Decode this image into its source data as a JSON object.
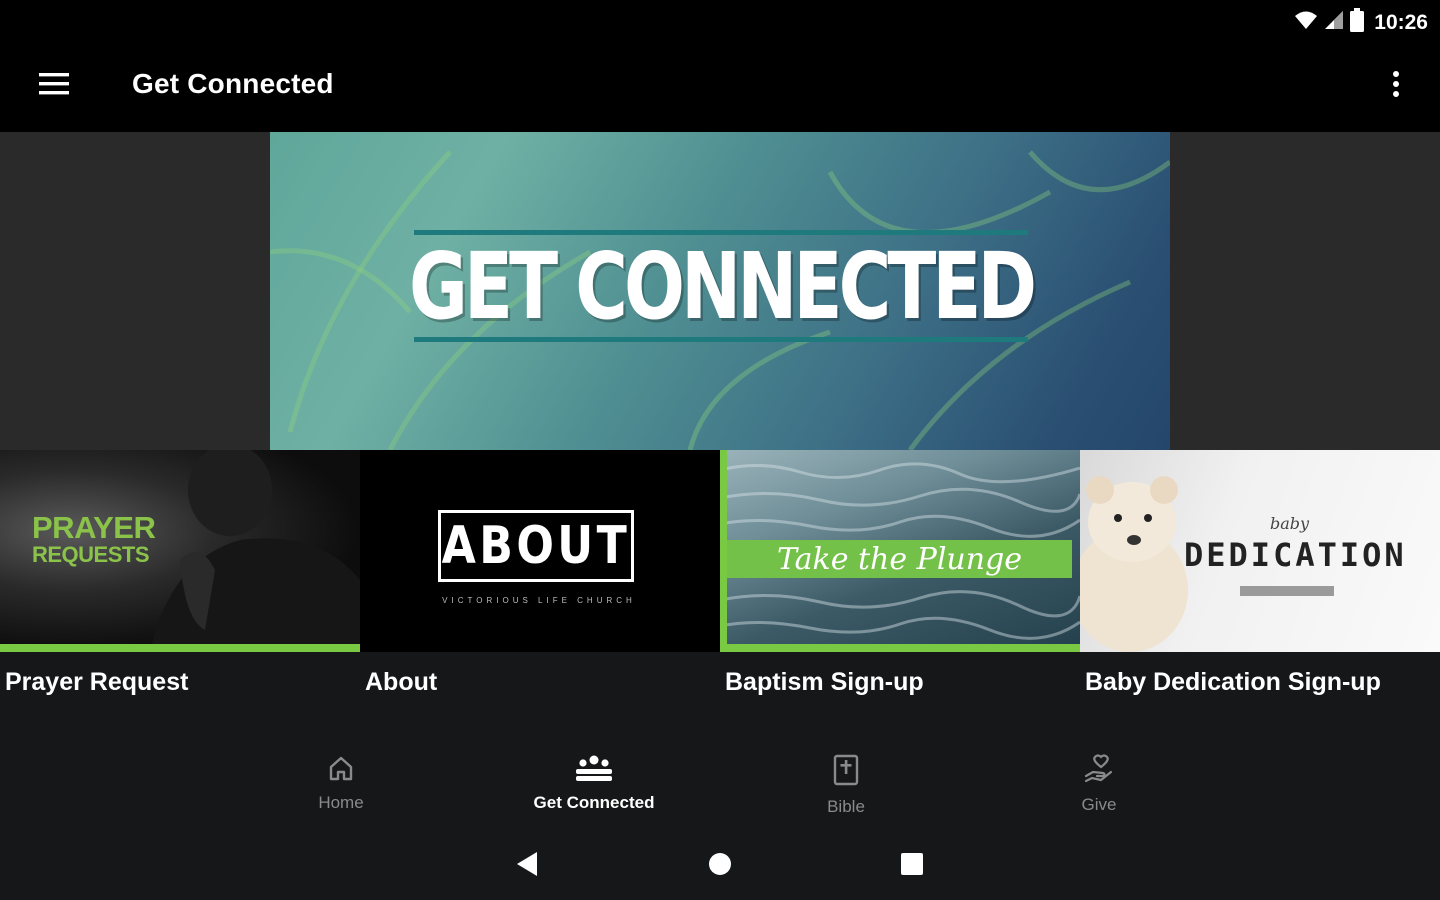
{
  "status_bar": {
    "time": "10:26",
    "icons": [
      "wifi-icon",
      "signal-icon",
      "battery-icon"
    ]
  },
  "app_bar": {
    "title": "Get Connected",
    "menu_icon": "hamburger-menu-icon",
    "overflow_icon": "more-vert-icon"
  },
  "hero": {
    "title": "GET CONNECTED"
  },
  "tiles": [
    {
      "label": "Prayer Request",
      "image_text": [
        "PRAYER",
        "REQUESTS"
      ]
    },
    {
      "label": "About",
      "image_text": [
        "ABOUT",
        "VICTORIOUS LIFE CHURCH"
      ]
    },
    {
      "label": "Baptism Sign-up",
      "image_text": [
        "Take the Plunge"
      ]
    },
    {
      "label": "Baby Dedication Sign-up",
      "image_text": [
        "baby",
        "DEDICATION"
      ]
    }
  ],
  "bottom_nav": {
    "items": [
      {
        "label": "Home",
        "icon": "home-icon"
      },
      {
        "label": "Get Connected",
        "icon": "group-icon",
        "active": true
      },
      {
        "label": "Bible",
        "icon": "bible-icon"
      },
      {
        "label": "Give",
        "icon": "give-hand-icon"
      }
    ]
  },
  "colors": {
    "accent_green": "#7ac943",
    "background": "#161718",
    "app_bar": "#000000"
  }
}
